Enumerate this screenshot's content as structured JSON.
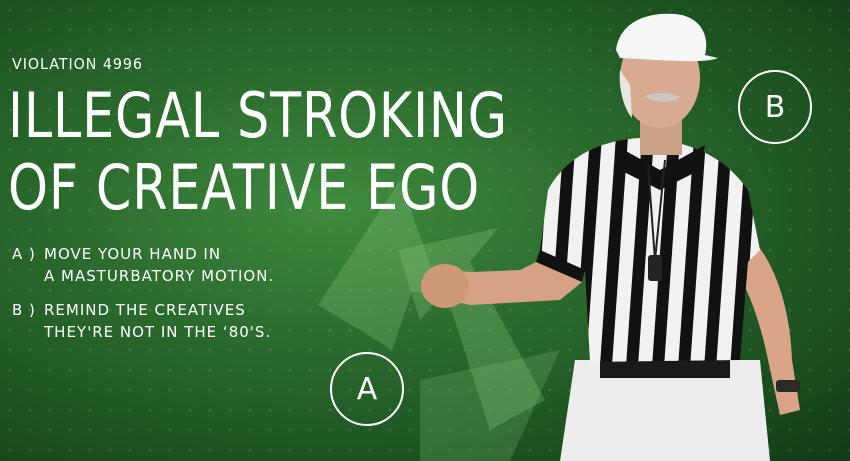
{
  "header": {
    "violation": "VIOLATION 4996"
  },
  "title": {
    "line1": "ILLEGAL STROKING",
    "line2": "OF CREATIVE EGO"
  },
  "instructions": [
    {
      "key": "A )",
      "line1": "MOVE YOUR HAND IN",
      "line2": "A MASTURBATORY MOTION."
    },
    {
      "key": "B )",
      "line1": "REMIND THE CREATIVES",
      "line2": "THEY'RE NOT IN THE ‘80'S."
    }
  ],
  "markers": {
    "a": "A",
    "b": "B"
  },
  "colors": {
    "background": "#2c6d2e",
    "text": "#ffffff",
    "arrow": "#7fc27c"
  }
}
